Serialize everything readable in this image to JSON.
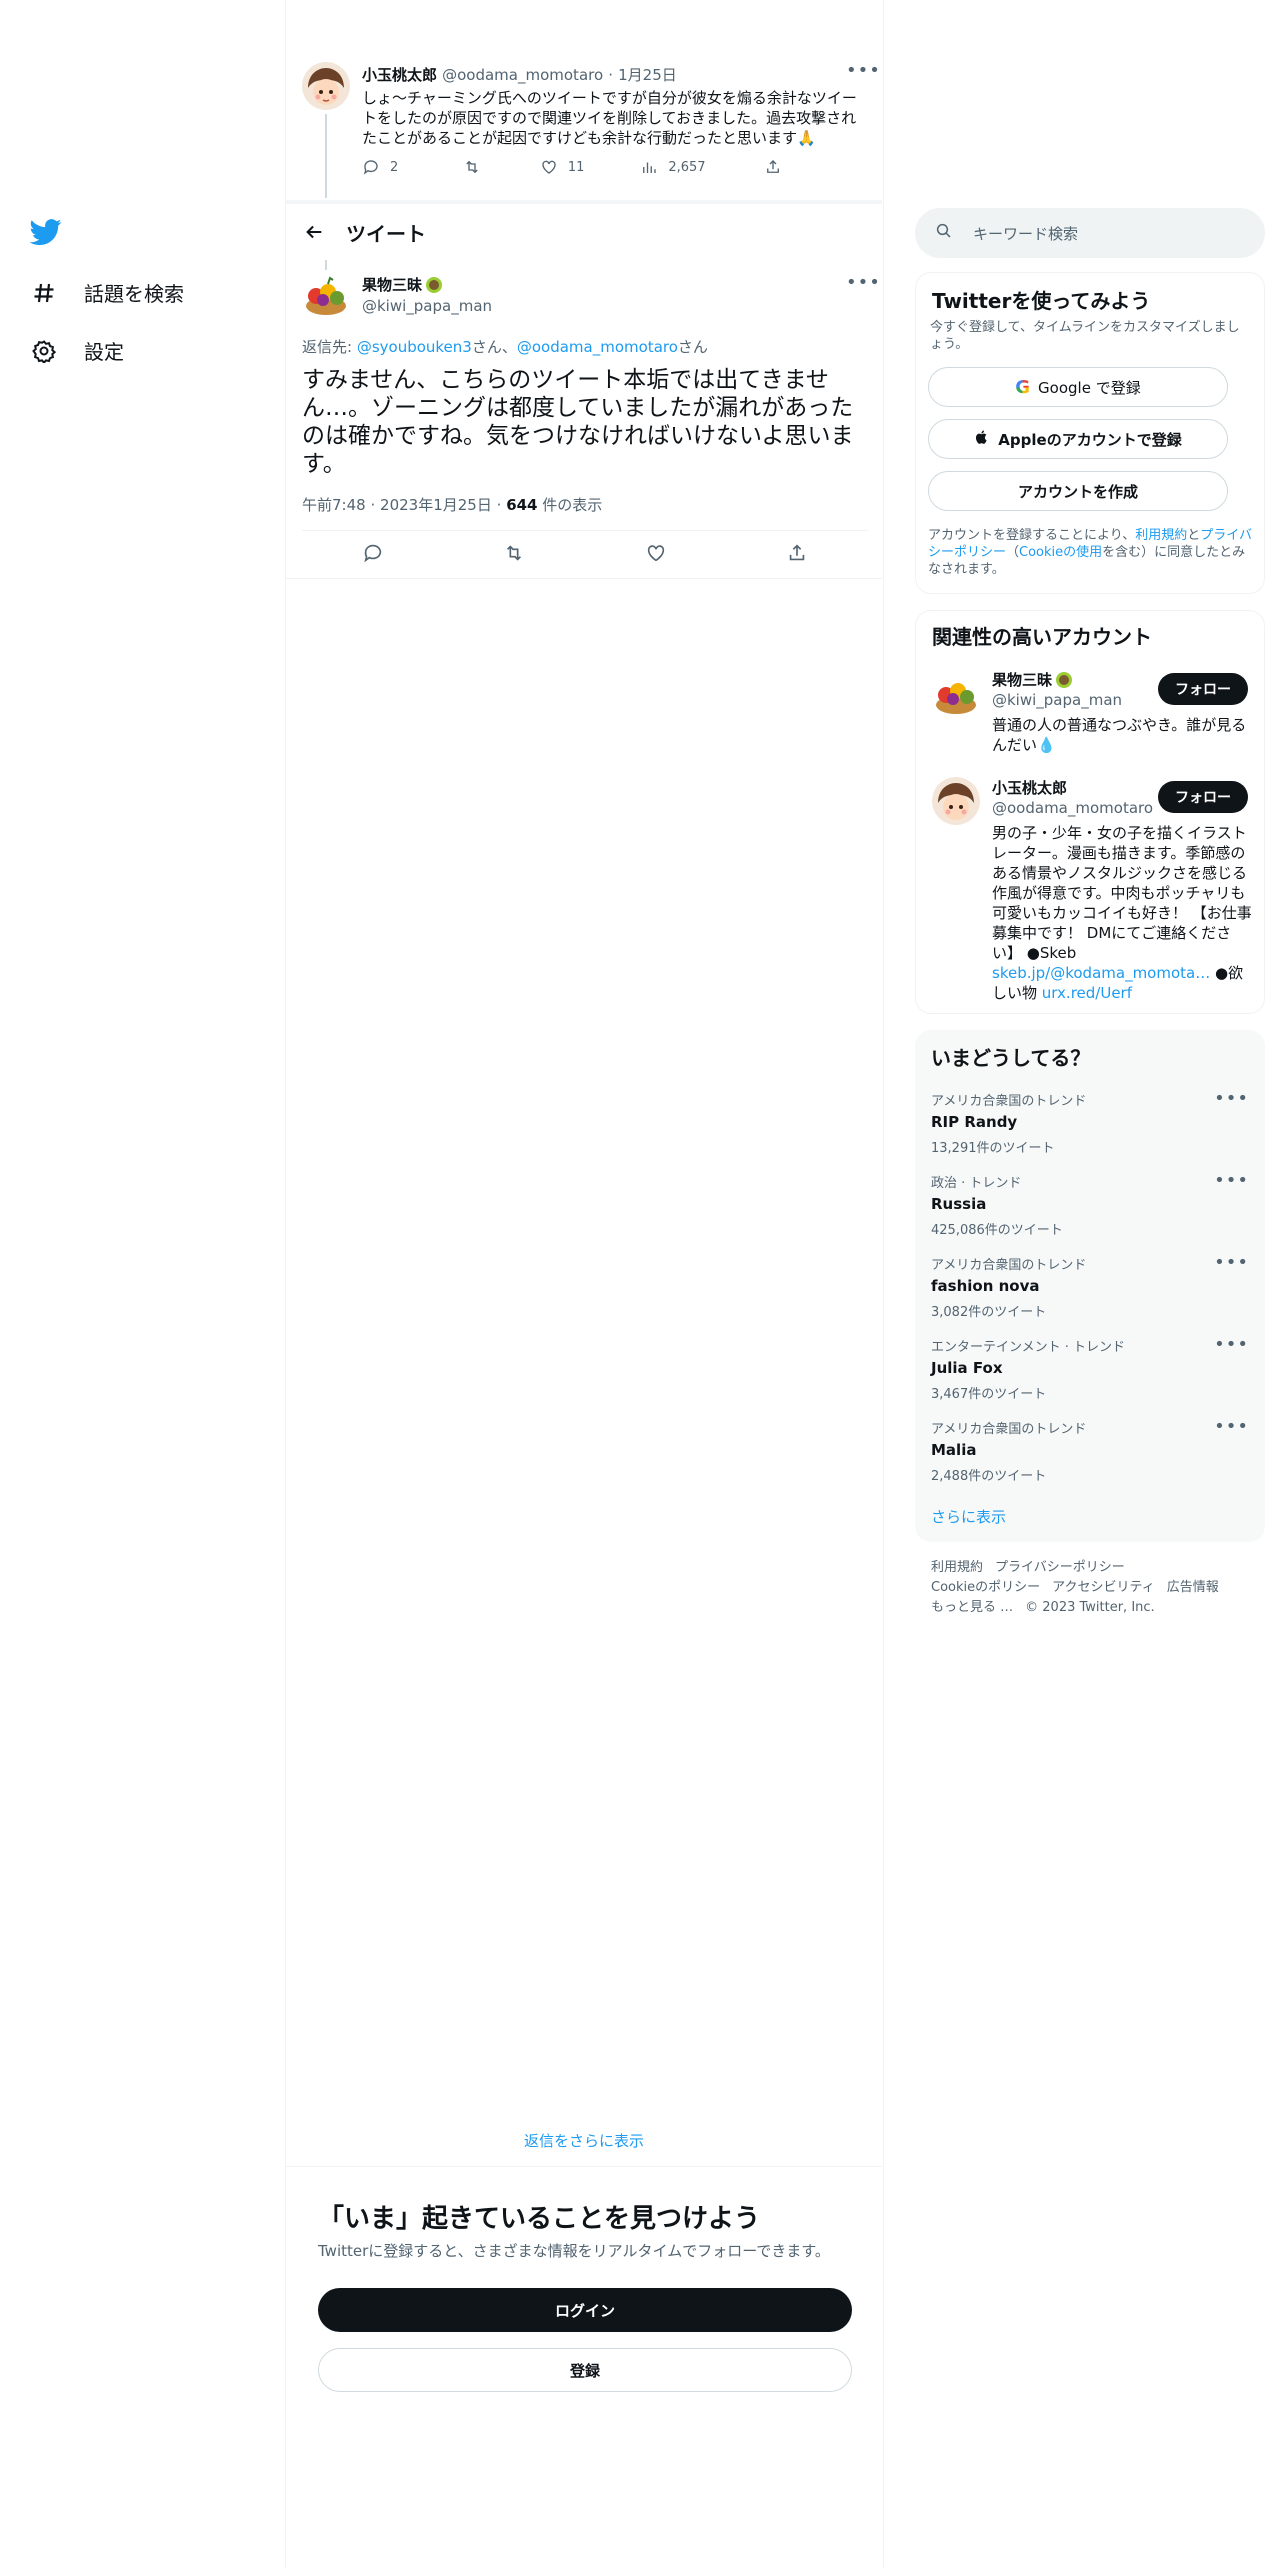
{
  "nav": {
    "explore_label": "話題を検索",
    "settings_label": "設定"
  },
  "prev_tweet": {
    "display_name": "小玉桃太郎",
    "handle": "@oodama_momotaro",
    "sep": "·",
    "date": "1月25日",
    "text": "しょ〜チャーミング氏へのツイートですが自分が彼女を煽る余計なツイートをしたのが原因ですので関連ツイを削除しておきました。過去攻撃されたことがあることが起因ですけども余計な行動だったと思います🙏",
    "replies": "2",
    "likes": "11",
    "views": "2,657"
  },
  "header": {
    "title": "ツイート"
  },
  "main_tweet": {
    "display_name": "果物三昧",
    "handle": "@kiwi_papa_man",
    "reply_prefix": "返信先: ",
    "reply_to_1": "@syoubouken3",
    "reply_mid": "さん、",
    "reply_to_2": "@oodama_momotaro",
    "reply_suffix": "さん",
    "text": "すみません、こちらのツイート本垢では出てきません…。ゾーニングは都度していましたが漏れがあったのは確かですね。気をつけなければいけないよ思います。",
    "time": "午前7:48",
    "sep": "·",
    "date": "2023年1月25日",
    "views_count": "644",
    "views_label": " 件の表示"
  },
  "more_replies": "返信をさらに表示",
  "login_prompt": {
    "title": "「いま」起きていることを見つけよう",
    "subtitle": "Twitterに登録すると、さまざまな情報をリアルタイムでフォローできます。",
    "login_label": "ログイン",
    "signup_label": "登録"
  },
  "search": {
    "placeholder": "キーワード検索"
  },
  "signup_card": {
    "title": "Twitterを使ってみよう",
    "subtitle": "今すぐ登録して、タイムラインをカスタマイズしましょう。",
    "google_label": "Google で登録",
    "apple_label": "Appleのアカウントで登録",
    "create_label": "アカウントを作成",
    "legal_prefix": "アカウントを登録することにより、",
    "terms": "利用規約",
    "and": "と",
    "privacy": "プライバシーポリシー",
    "paren_open": "（",
    "cookie": "Cookieの使用",
    "legal_suffix": "を含む）に同意したとみなされます。"
  },
  "related": {
    "title": "関連性の高いアカウント",
    "follow_label": "フォロー",
    "accounts": [
      {
        "name": "果物三昧",
        "handle": "@kiwi_papa_man",
        "bio": "普通の人の普通なつぶやき。誰が見るんだい💧"
      },
      {
        "name": "小玉桃太郎",
        "handle": "@oodama_momotaro",
        "bio": "男の子・少年・女の子を描くイラストレーター。漫画も描きます。季節感のある情景やノスタルジックさを感じる作風が得意です。中肉もポッチャリも可愛いもカッコイイも好き！ 【お仕事募集中です！ DMにてご連絡ください】 ●Skeb ",
        "link1": "skeb.jp/@kodama_momota…",
        "mid": " ●欲しい物 ",
        "link2": "urx.red/Uerf"
      }
    ]
  },
  "trends": {
    "title": "いまどうしてる？",
    "items": [
      {
        "meta": "アメリカ合衆国のトレンド",
        "name": "RIP Randy",
        "count": "13,291件のツイート"
      },
      {
        "meta": "政治 · トレンド",
        "name": "Russia",
        "count": "425,086件のツイート"
      },
      {
        "meta": "アメリカ合衆国のトレンド",
        "name": "fashion nova",
        "count": "3,082件のツイート"
      },
      {
        "meta": "エンターテインメント · トレンド",
        "name": "Julia Fox",
        "count": "3,467件のツイート"
      },
      {
        "meta": "アメリカ合衆国のトレンド",
        "name": "Malia",
        "count": "2,488件のツイート"
      }
    ],
    "show_more": "さらに表示"
  },
  "footer": {
    "terms": "利用規約",
    "privacy": "プライバシーポリシー",
    "cookie": "Cookieのポリシー",
    "accessibility": "アクセシビリティ",
    "ads": "広告情報",
    "more": "もっと見る …",
    "copyright": "© 2023 Twitter, Inc."
  },
  "colors": {
    "brand": "#1d9bf0",
    "text": "#0f1419",
    "muted": "#536471"
  }
}
